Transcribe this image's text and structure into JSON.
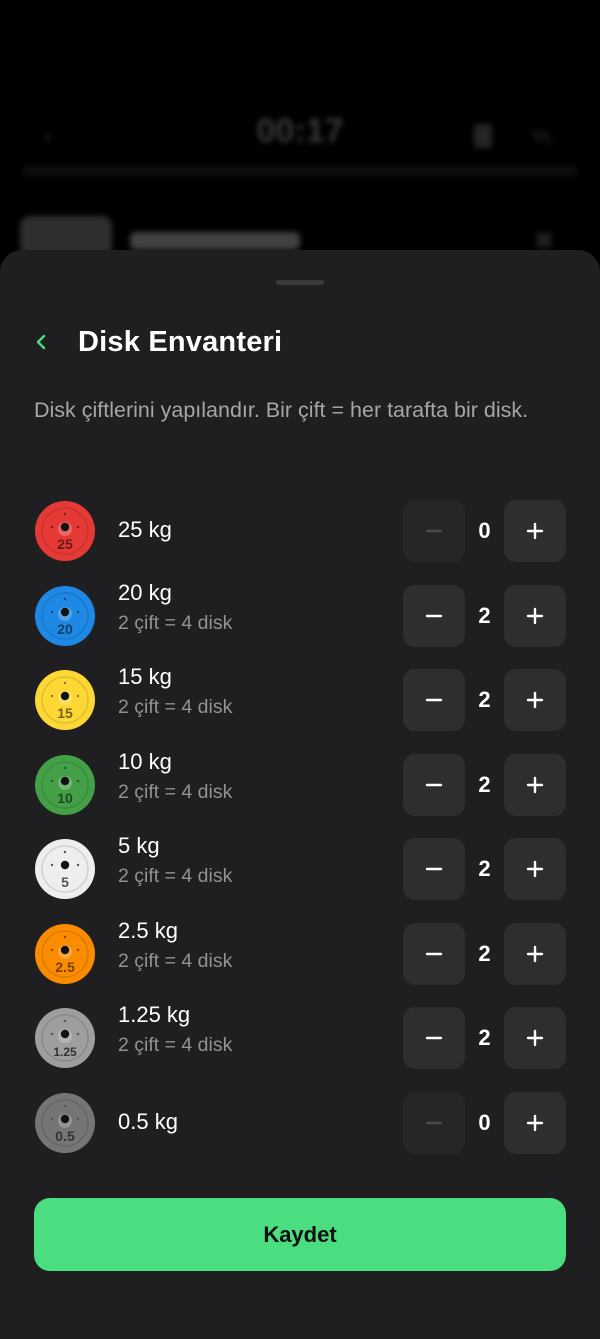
{
  "background": {
    "time": "00:17",
    "chip_label": "0 kg",
    "row_text": "Antrenman sayacı"
  },
  "sheet": {
    "title": "Disk Envanteri",
    "description": "Disk çiftlerini yapılandır. Bir çift = her tarafta bir disk.",
    "save_label": "Kaydet"
  },
  "plates": [
    {
      "weight": "25 kg",
      "label": "25",
      "subtitle": "",
      "count": "0",
      "color": "#e53935",
      "minus_enabled": false
    },
    {
      "weight": "20 kg",
      "label": "20",
      "subtitle": "2 çift = 4 disk",
      "count": "2",
      "color": "#1e88e5",
      "minus_enabled": true
    },
    {
      "weight": "15 kg",
      "label": "15",
      "subtitle": "2 çift = 4 disk",
      "count": "2",
      "color": "#fdd835",
      "minus_enabled": true
    },
    {
      "weight": "10 kg",
      "label": "10",
      "subtitle": "2 çift = 4 disk",
      "count": "2",
      "color": "#43a047",
      "minus_enabled": true
    },
    {
      "weight": "5 kg",
      "label": "5",
      "subtitle": "2 çift = 4 disk",
      "count": "2",
      "color": "#eeeeee",
      "minus_enabled": true
    },
    {
      "weight": "2.5 kg",
      "label": "2.5",
      "subtitle": "2 çift = 4 disk",
      "count": "2",
      "color": "#fb8c00",
      "minus_enabled": true
    },
    {
      "weight": "1.25 kg",
      "label": "1.25",
      "subtitle": "2 çift = 4 disk",
      "count": "2",
      "color": "#9e9e9e",
      "minus_enabled": true
    },
    {
      "weight": "0.5 kg",
      "label": "0.5",
      "subtitle": "",
      "count": "0",
      "color": "#757575",
      "minus_enabled": false
    }
  ],
  "colors": {
    "accent": "#4ade80",
    "sheet": "#1f1f21",
    "button": "#2e2e30"
  }
}
